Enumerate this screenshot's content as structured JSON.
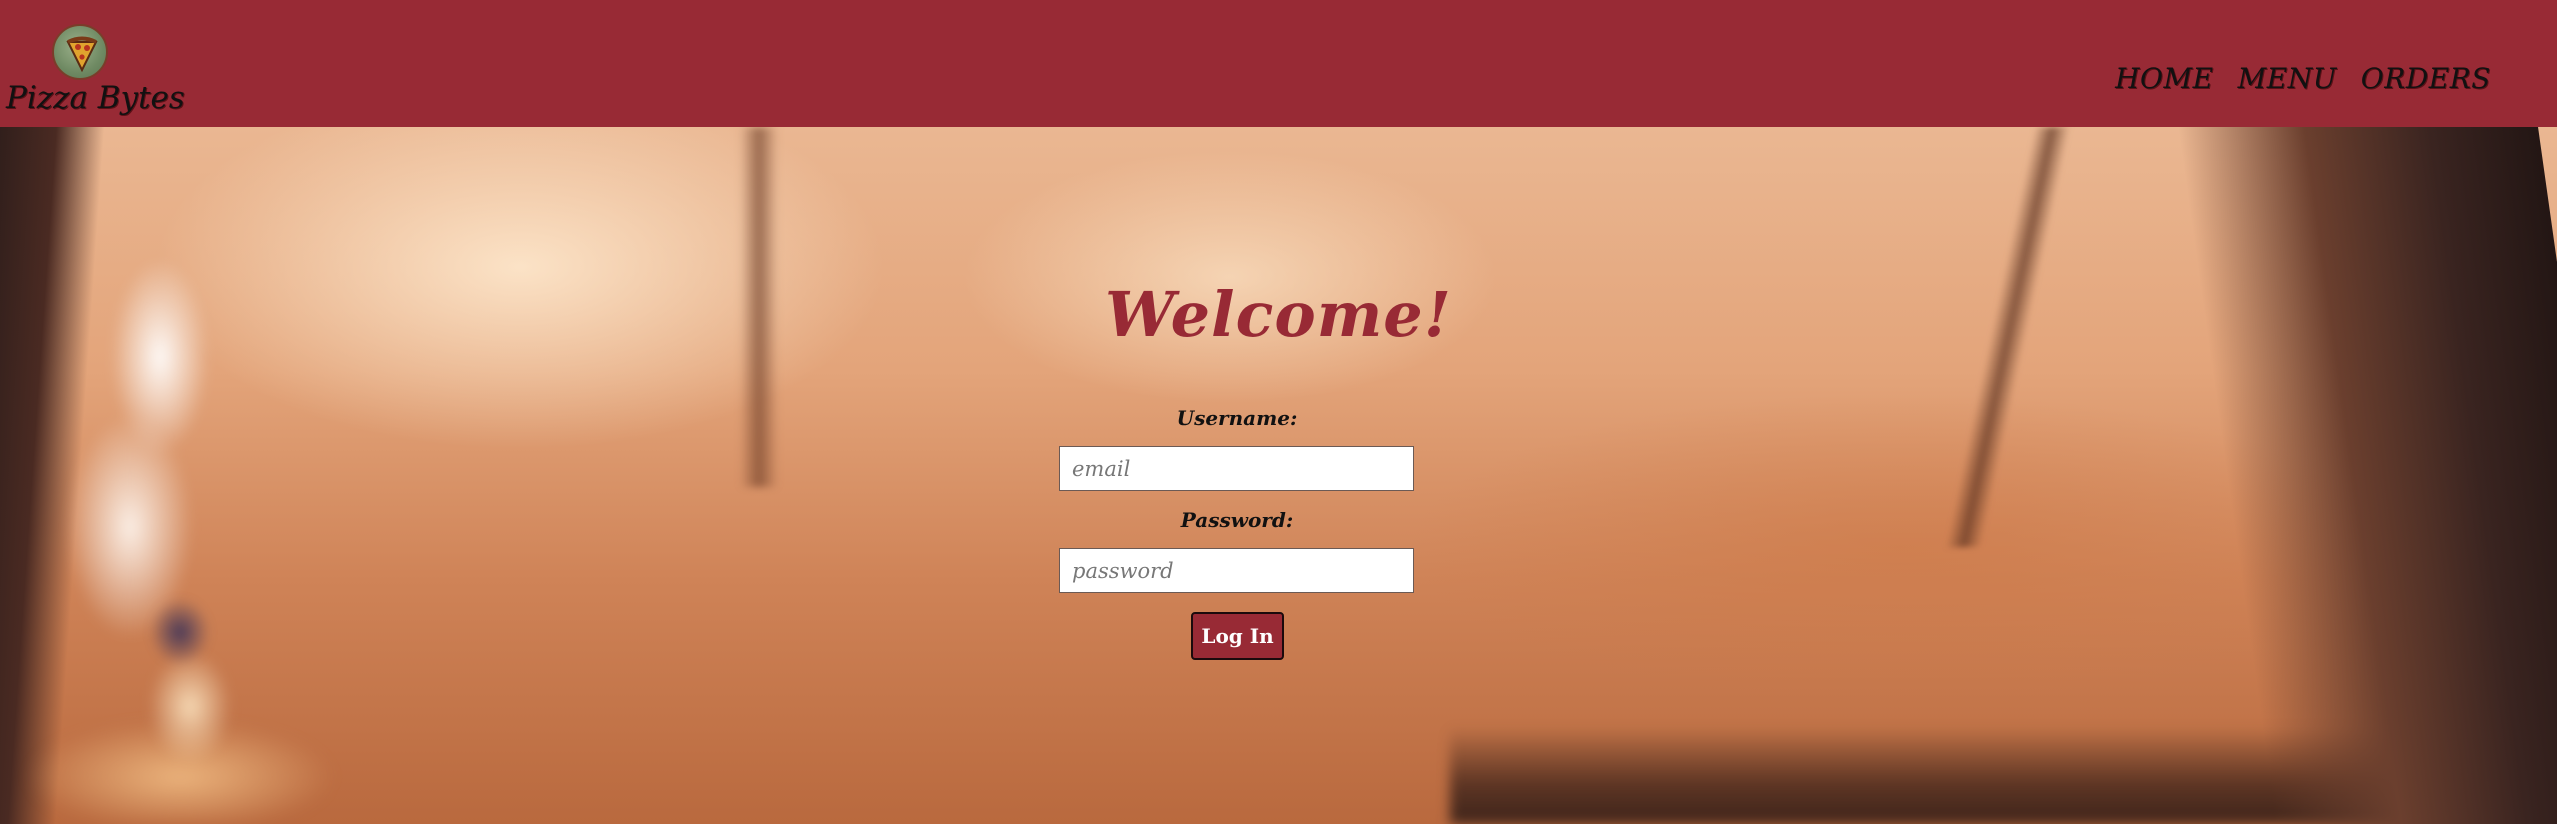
{
  "header": {
    "brand_name": "Pizza Bytes",
    "logo_icon": "pizza-logo-icon",
    "background_color": "#982a35",
    "nav": [
      {
        "label": "HOME"
      },
      {
        "label": "MENU"
      },
      {
        "label": "ORDERS"
      }
    ]
  },
  "login": {
    "title": "Welcome!",
    "title_color": "#982a35",
    "username_label": "Username:",
    "username_placeholder": "email",
    "username_value": "",
    "password_label": "Password:",
    "password_placeholder": "password",
    "password_value": "",
    "submit_label": "Log In",
    "button_color": "#982a35"
  },
  "hero": {
    "background": "blurred-pizza-oven-photo"
  }
}
